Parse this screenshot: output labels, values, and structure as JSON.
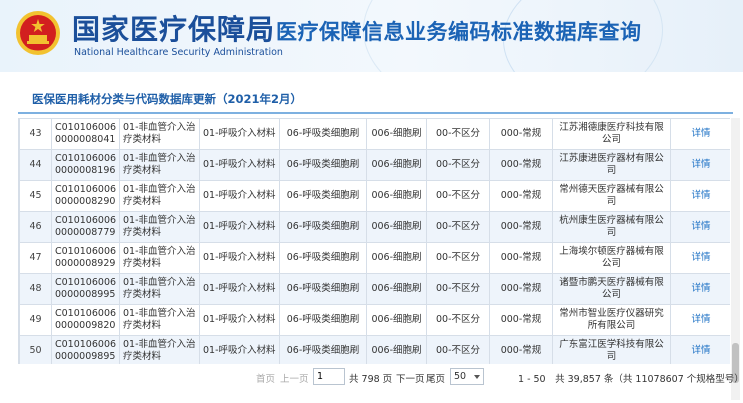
{
  "header": {
    "org_name_cn": "国家医疗保障局",
    "org_name_en": "National Healthcare Security Administration",
    "system_title": "医疗保障信息业务编码标准数据库查询"
  },
  "panel": {
    "title": "医保医用耗材分类与代码数据库更新（2021年2月）"
  },
  "table": {
    "rows": [
      {
        "index": "43",
        "code": "C010106006 0000008041",
        "cat1": "01-非血管介入治疗类材料",
        "cat2": "01-呼吸介入材料",
        "cat3": "06-呼吸类细胞刷",
        "name": "006-细胞刷",
        "material": "00-不区分",
        "spec": "000-常规",
        "company": "江苏湘德康医疗科技有限公司",
        "detail": "详情"
      },
      {
        "index": "44",
        "code": "C010106006 0000008196",
        "cat1": "01-非血管介入治疗类材料",
        "cat2": "01-呼吸介入材料",
        "cat3": "06-呼吸类细胞刷",
        "name": "006-细胞刷",
        "material": "00-不区分",
        "spec": "000-常规",
        "company": "江苏康进医疗器材有限公司",
        "detail": "详情"
      },
      {
        "index": "45",
        "code": "C010106006 0000008290",
        "cat1": "01-非血管介入治疗类材料",
        "cat2": "01-呼吸介入材料",
        "cat3": "06-呼吸类细胞刷",
        "name": "006-细胞刷",
        "material": "00-不区分",
        "spec": "000-常规",
        "company": "常州德天医疗器械有限公司",
        "detail": "详情"
      },
      {
        "index": "46",
        "code": "C010106006 0000008779",
        "cat1": "01-非血管介入治疗类材料",
        "cat2": "01-呼吸介入材料",
        "cat3": "06-呼吸类细胞刷",
        "name": "006-细胞刷",
        "material": "00-不区分",
        "spec": "000-常规",
        "company": "杭州康生医疗器械有限公司",
        "detail": "详情"
      },
      {
        "index": "47",
        "code": "C010106006 0000008929",
        "cat1": "01-非血管介入治疗类材料",
        "cat2": "01-呼吸介入材料",
        "cat3": "06-呼吸类细胞刷",
        "name": "006-细胞刷",
        "material": "00-不区分",
        "spec": "000-常规",
        "company": "上海埃尔顿医疗器械有限公司",
        "detail": "详情"
      },
      {
        "index": "48",
        "code": "C010106006 0000008995",
        "cat1": "01-非血管介入治疗类材料",
        "cat2": "01-呼吸介入材料",
        "cat3": "06-呼吸类细胞刷",
        "name": "006-细胞刷",
        "material": "00-不区分",
        "spec": "000-常规",
        "company": "诸暨市鹏天医疗器械有限公司",
        "detail": "详情"
      },
      {
        "index": "49",
        "code": "C010106006 0000009820",
        "cat1": "01-非血管介入治疗类材料",
        "cat2": "01-呼吸介入材料",
        "cat3": "06-呼吸类细胞刷",
        "name": "006-细胞刷",
        "material": "00-不区分",
        "spec": "000-常规",
        "company": "常州市智业医疗仪器研究所有限公司",
        "detail": "详情"
      },
      {
        "index": "50",
        "code": "C010106006 0000009895",
        "cat1": "01-非血管介入治疗类材料",
        "cat2": "01-呼吸介入材料",
        "cat3": "06-呼吸类细胞刷",
        "name": "006-细胞刷",
        "material": "00-不区分",
        "spec": "000-常规",
        "company": "广东富江医学科技有限公司",
        "detail": "详情"
      }
    ]
  },
  "pager": {
    "first": "首页",
    "prev": "上一页",
    "page_value": "1",
    "total_pages": "共 798 页",
    "next": "下一页",
    "last": "尾页",
    "page_size": "50",
    "summary": "1 - 50　共 39,857 条（共 11078607 个规格型号）"
  },
  "colors": {
    "brand_blue": "#1b4f9a",
    "title_blue": "#1b63b5",
    "link_blue": "#1a6fc4",
    "emblem_red": "#d21f1f",
    "emblem_gold": "#f2c230"
  }
}
